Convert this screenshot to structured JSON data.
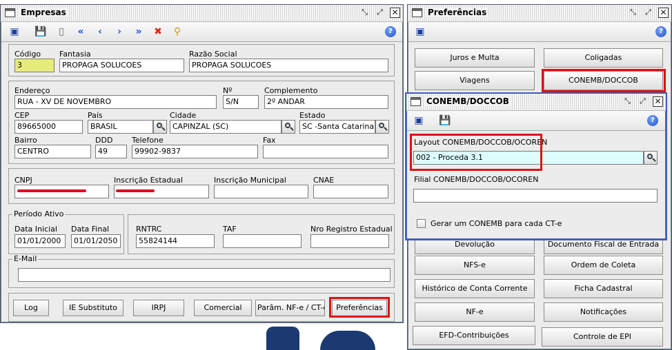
{
  "empresas": {
    "title": "Empresas",
    "help_label": "?",
    "labels": {
      "codigo": "Código",
      "fantasia": "Fantasia",
      "razao_social": "Razão Social",
      "endereco": "Endereço",
      "numero": "Nº",
      "complemento": "Complemento",
      "cep": "CEP",
      "pais": "País",
      "cidade": "Cidade",
      "estado": "Estado",
      "bairro": "Bairro",
      "ddd": "DDD",
      "telefone": "Telefone",
      "fax": "Fax",
      "cnpj": "CNPJ",
      "inscricao_estadual": "Inscrição Estadual",
      "inscricao_municipal": "Inscrição Municipal",
      "cnae": "CNAE",
      "periodo_ativo": "Período Ativo",
      "data_inicial": "Data Inicial",
      "data_final": "Data Final",
      "rntrc": "RNTRC",
      "taf": "TAF",
      "nro_registro_estadual": "Nro Registro Estadual",
      "email": "E-Mail"
    },
    "values": {
      "codigo": "3",
      "fantasia": "PROPAGA SOLUCOES",
      "razao_social": "PROPAGA SOLUCOES",
      "endereco": "RUA - XV DE NOVEMBRO",
      "numero": "S/N",
      "complemento": "2º ANDAR",
      "cep": "89665000",
      "pais": "BRASIL",
      "cidade": "CAPINZAL (SC)",
      "estado": "SC -Santa Catarina",
      "bairro": "CENTRO",
      "ddd": "49",
      "telefone": "99902-9837",
      "fax": "",
      "cnpj": "",
      "inscricao_estadual": "",
      "inscricao_municipal": "",
      "cnae": "",
      "data_inicial": "01/01/2000",
      "data_final": "01/01/2050",
      "rntrc": "55824144",
      "taf": "",
      "nro_registro_estadual": "",
      "email": ""
    },
    "buttons": {
      "log": "Log",
      "ie_substituto": "IE Substituto",
      "irpj": "IRPJ",
      "comercial": "Comercial",
      "param_nfe": "Parâm. NF-e / CT-e",
      "preferencias": "Preferências"
    }
  },
  "preferencias": {
    "title": "Preferências",
    "help_label": "?",
    "buttons": {
      "juros_multa": "Juros e Multa",
      "coligadas": "Coligadas",
      "viagens": "Viagens",
      "conemb_doccob": "CONEMB/DOCCOB",
      "devolucao": "Devolução",
      "documento_fiscal_entrada": "Documento Fiscal de Entrada",
      "nfse": "NFS-e",
      "ordem_coleta": "Ordem de Coleta",
      "historico_conta_corrente": "Histórico de Conta Corrente",
      "ficha_cadastral": "Ficha Cadastral",
      "nfe": "NF-e",
      "notificacoes": "Notificações",
      "efd_contribuicoes": "EFD-Contribuições",
      "controle_epi": "Controle de EPI"
    }
  },
  "conemb": {
    "title": "CONEMB/DOCCOB",
    "help_label": "?",
    "labels": {
      "layout": "Layout CONEMB/DOCCOB/OCOREN",
      "filial": "Filial CONEMB/DOCCOB/OCOREN",
      "gerar": "Gerar um CONEMB para cada CT-e"
    },
    "values": {
      "layout": "002 - Proceda 3.1",
      "filial": ""
    }
  },
  "colors": {
    "highlight": "#e01010",
    "codigo_bg": "#e6ec7a",
    "layout_bg": "#ddfdfd",
    "window_frame": "#6f7f93"
  }
}
